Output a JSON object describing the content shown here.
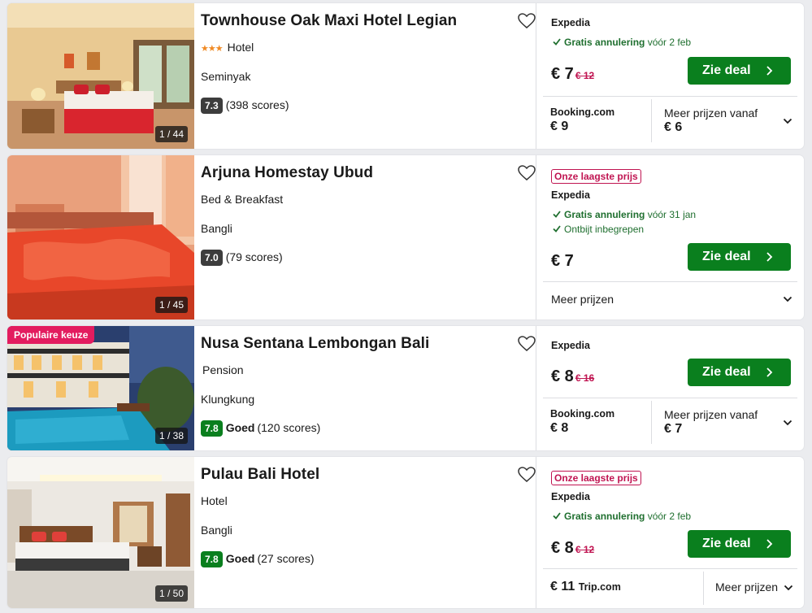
{
  "hotels": [
    {
      "name": "Townhouse Oak Maxi Hotel Legian",
      "stars": "★★★",
      "type": "Hotel",
      "location": "Seminyak",
      "score": "7.3",
      "score_label": "",
      "reviews": "(398 scores)",
      "photo_counter": "1 / 44",
      "provider": "Expedia",
      "perk1_bold": "Gratis annulering",
      "perk1_rest": "vóór 2 feb",
      "price": "€ 7",
      "old_price": "€ 12",
      "deal_button": "Zie deal",
      "alt_provider": "Booking.com",
      "alt_price": "€ 9",
      "more_label": "Meer prijzen vanaf",
      "more_price": "€ 6"
    },
    {
      "name": "Arjuna Homestay Ubud",
      "type": "Bed & Breakfast",
      "location": "Bangli",
      "score": "7.0",
      "reviews": "(79 scores)",
      "photo_counter": "1 / 45",
      "lowest_badge": "Onze laagste prijs",
      "provider": "Expedia",
      "perk1_bold": "Gratis annulering",
      "perk1_rest": "vóór 31 jan",
      "perk2": "Ontbijt inbegrepen",
      "price": "€ 7",
      "deal_button": "Zie deal",
      "more_label": "Meer prijzen"
    },
    {
      "name": "Nusa Sentana Lembongan Bali",
      "badge": "Populaire keuze",
      "type": "Pension",
      "location": "Klungkung",
      "score": "7.8",
      "score_label": "Goed",
      "reviews": "(120 scores)",
      "photo_counter": "1 / 38",
      "provider": "Expedia",
      "price": "€ 8",
      "old_price": "€ 16",
      "deal_button": "Zie deal",
      "alt_provider": "Booking.com",
      "alt_price": "€ 8",
      "more_label": "Meer prijzen vanaf",
      "more_price": "€ 7"
    },
    {
      "name": "Pulau Bali Hotel",
      "type": "Hotel",
      "location": "Bangli",
      "score": "7.8",
      "score_label": "Goed",
      "reviews": "(27 scores)",
      "photo_counter": "1 / 50",
      "lowest_badge": "Onze laagste prijs",
      "provider": "Expedia",
      "perk1_bold": "Gratis annulering",
      "perk1_rest": "vóór 2 feb",
      "price": "€ 8",
      "old_price": "€ 12",
      "deal_button": "Zie deal",
      "alt_price": "€ 11",
      "alt_provider": "Trip.com",
      "more_label": "Meer prijzen"
    }
  ],
  "colors": {
    "deal_green": "#0a7f1e",
    "score_green": "#0a7f1e",
    "score_dark": "#3d3d3d",
    "accent_red": "#c01451",
    "popular_pink": "#e31c5f",
    "star_orange": "#f08a24"
  },
  "icons": [
    "heart-icon",
    "check-icon",
    "chevron-right-icon",
    "chevron-down-icon"
  ]
}
